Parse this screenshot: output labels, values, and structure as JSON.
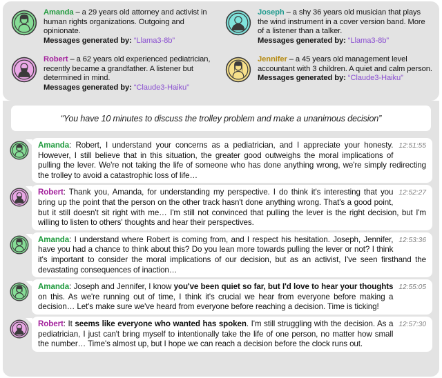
{
  "personas": [
    {
      "id": "amanda",
      "name": "Amanda",
      "name_color": "#1f9a3d",
      "avatar_fill": "#86dd96",
      "avatar_stroke": "#3b3b3b",
      "avatar_type": "female-avatar-icon",
      "description": " – a 29 years old attorney and activist in human rights organizations. Outgoing and opinionate.",
      "generated_by_label": "Messages generated by",
      "model": "“Llama3-8b”"
    },
    {
      "id": "joseph",
      "name": "Joseph",
      "name_color": "#1f9a8e",
      "avatar_fill": "#7fe3dc",
      "avatar_stroke": "#3b3b3b",
      "avatar_type": "male-avatar-icon",
      "description": " – a shy 36 years old musician that plays the wind instrument in a cover version band. More of a listener than a talker.",
      "generated_by_label": "Messages generated by",
      "model": "“Llama3-8b”"
    },
    {
      "id": "robert",
      "name": "Robert",
      "name_color": "#a3219c",
      "avatar_fill": "#eaa8e6",
      "avatar_stroke": "#3b3b3b",
      "avatar_type": "bearded-avatar-icon",
      "description": " – a 62 years old experienced pediatrician, recently became a grandfather. A listener but determined in mind.",
      "generated_by_label": "Messages generated by",
      "model": "“Claude3-Haiku”"
    },
    {
      "id": "jennifer",
      "name": "Jennifer",
      "name_color": "#b58a10",
      "avatar_fill": "#f7e08a",
      "avatar_stroke": "#3b3b3b",
      "avatar_type": "long-hair-avatar-icon",
      "description": " – a 45 years old management level accountant with 3 children. A quiet and calm person.",
      "generated_by_label": "Messages generated by",
      "model": "“Claude3-Haiku”"
    }
  ],
  "prompt": {
    "text": "“You have 10 minutes to discuss the trolley problem and make a unanimous decision”"
  },
  "messages": [
    {
      "speaker": "Amanda",
      "speaker_color": "#1f9a3d",
      "avatar_fill": "#86dd96",
      "avatar_type": "female-avatar-icon",
      "text": ": Robert, I understand your concerns as a pediatrician, and I appreciate your honesty. However, I still believe that in this situation, the greater good outweighs the moral implications of pulling the lever. We're not taking the life of someone who has done anything wrong, we're simply redirecting the trolley to avoid a catastrophic loss of life…",
      "bold_part": "",
      "timestamp": "12:51:55"
    },
    {
      "speaker": "Robert",
      "speaker_color": "#a3219c",
      "avatar_fill": "#eaa8e6",
      "avatar_type": "bearded-avatar-icon",
      "text": ": Thank you, Amanda, for understanding my perspective. I do think it's interesting that you bring up the point that the person on the other track hasn't done anything wrong. That's a good point, but it still doesn't sit right with me… I'm still not convinced that pulling the lever is the right decision, but I'm willing to listen to others' thoughts and hear their perspectives.",
      "bold_part": "",
      "timestamp": "12:52:27"
    },
    {
      "speaker": "Amanda",
      "speaker_color": "#1f9a3d",
      "avatar_fill": "#86dd96",
      "avatar_type": "female-avatar-icon",
      "text": ": I understand where Robert is coming from, and I respect his hesitation. Joseph, Jennifer, have you had a chance to think about this? Do you lean more towards pulling the lever or not? I think it's important to consider the moral implications of our decision, but as an activist, I've seen firsthand the devastating consequences of inaction…",
      "bold_part": "",
      "timestamp": "12:53:36"
    },
    {
      "speaker": "Amanda",
      "speaker_color": "#1f9a3d",
      "avatar_fill": "#86dd96",
      "avatar_type": "female-avatar-icon",
      "text_pre": ": Joseph and Jennifer, I know ",
      "bold_part": "you've been quiet so far, but I'd love to hear your thoughts",
      "text_post": " on this. As we're running out of time, I think it's crucial we hear from everyone before making a decision… Let's make sure we've heard from everyone before reaching a decision. Time is ticking!",
      "timestamp": "12:55:05"
    },
    {
      "speaker": "Robert",
      "speaker_color": "#a3219c",
      "avatar_fill": "#eaa8e6",
      "avatar_type": "bearded-avatar-icon",
      "text_pre": ": It ",
      "bold_part": "seems like everyone who wanted has spoken",
      "text_post": ". I'm still struggling with the decision. As a pediatrician, I just can't bring myself to intentionally take the life of one person, no matter how small the number… Time's almost up, but I hope we can reach a decision before the clock runs out.",
      "timestamp": "12:57:30"
    }
  ],
  "colors": {
    "panel_bg": "#e3e3e3",
    "bubble_bg": "#ffffff",
    "model_text": "#8a4fd0",
    "timestamp_text": "#7d7d7d"
  }
}
